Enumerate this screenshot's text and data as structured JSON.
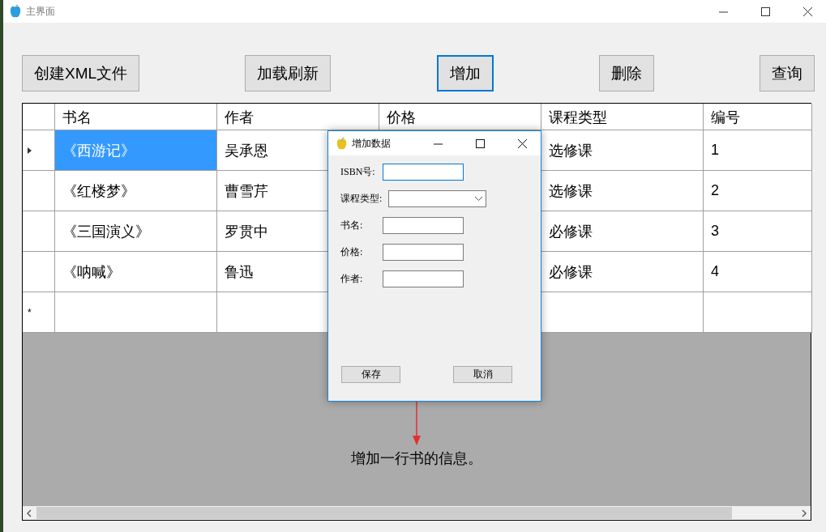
{
  "window": {
    "title": "主界面"
  },
  "toolbar": [
    {
      "label": "创建XML文件",
      "focused": false
    },
    {
      "label": "加载刷新",
      "focused": false
    },
    {
      "label": "增加",
      "focused": true
    },
    {
      "label": "删除",
      "focused": false
    },
    {
      "label": "查询",
      "focused": false
    }
  ],
  "table": {
    "columns": [
      "书名",
      "作者",
      "价格",
      "课程类型",
      "编号"
    ],
    "rows": [
      {
        "current": true,
        "book": {
          "text": "《西游记》",
          "selected": true
        },
        "author": "吴承恩",
        "course_type": "选修课",
        "id": "1"
      },
      {
        "current": false,
        "book": {
          "text": "《红楼梦》",
          "selected": false
        },
        "author": "曹雪芹",
        "course_type": "选修课",
        "id": "2"
      },
      {
        "current": false,
        "book": {
          "text": "《三国演义》",
          "selected": false
        },
        "author": "罗贯中",
        "course_type": "必修课",
        "id": "3"
      },
      {
        "current": false,
        "book": {
          "text": "《呐喊》",
          "selected": false
        },
        "author": "鲁迅",
        "course_type": "必修课",
        "id": "4"
      }
    ],
    "new_row_marker": "*"
  },
  "dialog": {
    "title": "增加数据",
    "fields": [
      {
        "kind": "text",
        "label": "ISBN号:",
        "focused": true
      },
      {
        "kind": "select",
        "label": "课程类型:",
        "focused": false
      },
      {
        "kind": "text",
        "label": "书名:",
        "focused": false
      },
      {
        "kind": "text",
        "label": "价格:",
        "focused": false
      },
      {
        "kind": "text",
        "label": "作者:",
        "focused": false
      }
    ],
    "buttons": [
      "保存",
      "取消"
    ]
  },
  "annotation": {
    "text": "增加一行书的信息。"
  }
}
